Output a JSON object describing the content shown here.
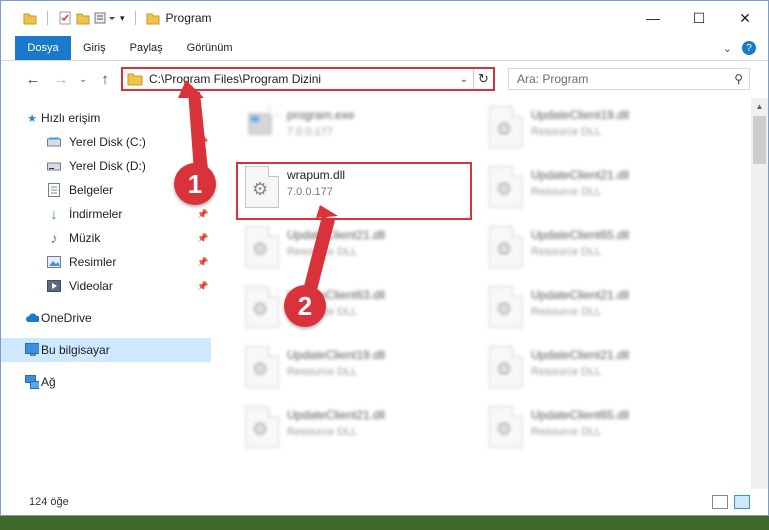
{
  "window": {
    "title": "Program",
    "controls": {
      "minimize": "—",
      "maximize": "☐",
      "close": "✕"
    }
  },
  "ribbon": {
    "tabs": [
      "Dosya",
      "Giriş",
      "Paylaş",
      "Görünüm"
    ],
    "help": "?"
  },
  "address": {
    "path": "C:\\Program Files\\Program Dizini",
    "search_placeholder": "Ara: Program"
  },
  "sidebar": {
    "quick_access": "Hızlı erişim",
    "pinned": [
      {
        "label": "Yerel Disk (C:)",
        "icon": "drive-icon"
      },
      {
        "label": "Yerel Disk (D:)",
        "icon": "drive-icon"
      },
      {
        "label": "Belgeler",
        "icon": "documents-icon"
      },
      {
        "label": "İndirmeler",
        "icon": "download-icon"
      },
      {
        "label": "Müzik",
        "icon": "music-icon"
      },
      {
        "label": "Resimler",
        "icon": "pictures-icon"
      },
      {
        "label": "Videolar",
        "icon": "videos-icon"
      }
    ],
    "onedrive": "OneDrive",
    "this_pc": "Bu bilgisayar",
    "network": "Ağ"
  },
  "files": [
    {
      "name": "program.exe",
      "sub": "7.0.0.177",
      "blurred": true
    },
    {
      "name": "UpdateClient19.dll",
      "sub": "Resource DLL",
      "blurred": true
    },
    {
      "name": "wrapum.dll",
      "sub": "7.0.0.177",
      "blurred": false
    },
    {
      "name": "UpdateClient21.dll",
      "sub": "Resource DLL",
      "blurred": true
    },
    {
      "name": "UpdateClient21.dll",
      "sub": "Resource DLL",
      "blurred": true
    },
    {
      "name": "UpdateClient65.dll",
      "sub": "Resource DLL",
      "blurred": true
    },
    {
      "name": "UpdateClient63.dll",
      "sub": "Resource DLL",
      "blurred": true
    },
    {
      "name": "UpdateClient21.dll",
      "sub": "Resource DLL",
      "blurred": true
    },
    {
      "name": "UpdateClient19.dll",
      "sub": "Resource DLL",
      "blurred": true
    },
    {
      "name": "UpdateClient21.dll",
      "sub": "Resource DLL",
      "blurred": true
    },
    {
      "name": "UpdateClient21.dll",
      "sub": "Resource DLL",
      "blurred": true
    },
    {
      "name": "UpdateClient65.dll",
      "sub": "Resource DLL",
      "blurred": true
    }
  ],
  "status": {
    "count": "124 öğe"
  },
  "callouts": [
    "1",
    "2"
  ],
  "colors": {
    "accent": "#1979ca",
    "highlight": "#d9323a",
    "selected": "#cde8ff"
  }
}
